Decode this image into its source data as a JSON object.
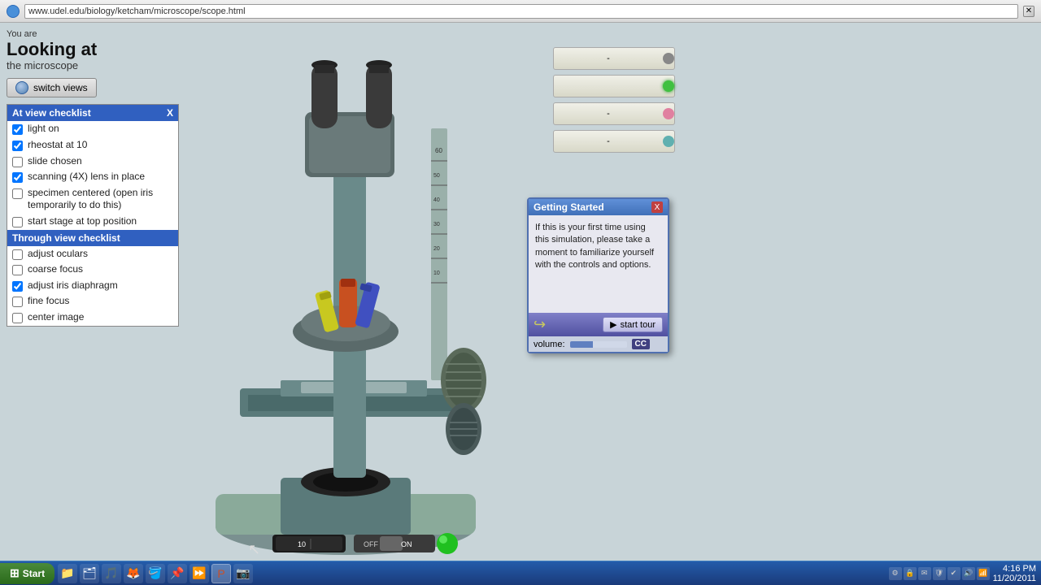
{
  "browser": {
    "url": "www.udel.edu/biology/ketcham/microscope/scope.html",
    "close_label": "X"
  },
  "header": {
    "you_are": "You are",
    "looking_at": "Looking at",
    "the_microscope": "the microscope",
    "switch_views": "switch views"
  },
  "at_view_checklist": {
    "title": "At view checklist",
    "close": "X",
    "items": [
      {
        "label": "light on",
        "checked": true
      },
      {
        "label": "rheostat at 10",
        "checked": true
      },
      {
        "label": "slide chosen",
        "checked": false
      },
      {
        "label": "scanning (4X) lens in place",
        "checked": true
      },
      {
        "label": "specimen centered (open iris temporarily to do this)",
        "checked": false
      },
      {
        "label": "start stage at top position",
        "checked": false
      }
    ]
  },
  "through_checklist": {
    "title": "Through view checklist",
    "items": [
      {
        "label": "adjust oculars",
        "checked": false
      },
      {
        "label": "coarse focus",
        "checked": false
      },
      {
        "label": "adjust iris diaphragm",
        "checked": true
      },
      {
        "label": "fine focus",
        "checked": false
      },
      {
        "label": "center image",
        "checked": false
      }
    ]
  },
  "control_buttons": [
    {
      "label": "-",
      "dot_class": "dot-dash"
    },
    {
      "label": "",
      "dot_class": "dot-green"
    },
    {
      "label": "-",
      "dot_class": "dot-pink"
    },
    {
      "label": "-",
      "dot_class": "dot-teal"
    }
  ],
  "dialog": {
    "title": "Getting Started",
    "close": "X",
    "body": "If this  is your first time using this simulation, please take a moment to familiarize yourself with the controls and options.",
    "start_tour": "start tour",
    "volume_label": "volume:",
    "cc_label": "CC"
  },
  "power": {
    "rheostat_label": "10",
    "off_label": "OFF",
    "on_label": "ON"
  },
  "taskbar": {
    "start_label": "Start",
    "time": "4:16 PM",
    "date": "11/20/2011"
  }
}
